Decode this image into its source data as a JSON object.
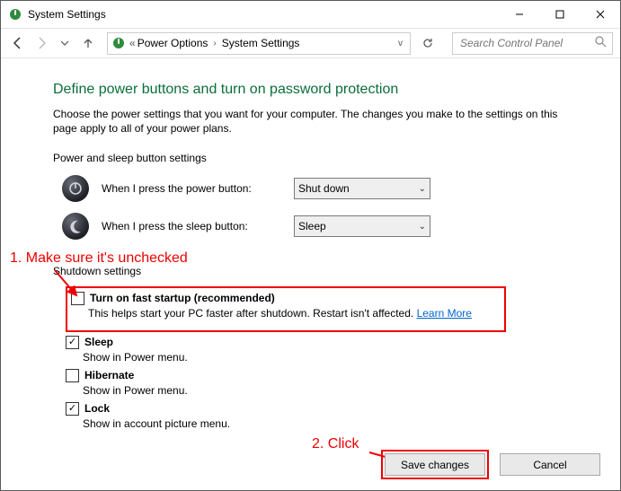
{
  "window": {
    "title": "System Settings"
  },
  "nav": {
    "breadcrumb": {
      "part1": "Power Options",
      "part2": "System Settings"
    },
    "search_placeholder": "Search Control Panel"
  },
  "page": {
    "heading": "Define power buttons and turn on password protection",
    "subhead": "Choose the power settings that you want for your computer. The changes you make to the settings on this page apply to all of your power plans.",
    "section_power_sleep": "Power and sleep button settings",
    "power_button_label": "When I press the power button:",
    "power_button_value": "Shut down",
    "sleep_button_label": "When I press the sleep button:",
    "sleep_button_value": "Sleep",
    "section_shutdown": "Shutdown settings",
    "fast_startup": {
      "label": "Turn on fast startup (recommended)",
      "desc": "This helps start your PC faster after shutdown. Restart isn't affected. ",
      "learn_more": "Learn More"
    },
    "sleep_opt": {
      "label": "Sleep",
      "desc": "Show in Power menu."
    },
    "hibernate_opt": {
      "label": "Hibernate",
      "desc": "Show in Power menu."
    },
    "lock_opt": {
      "label": "Lock",
      "desc": "Show in account picture menu."
    }
  },
  "buttons": {
    "save": "Save changes",
    "cancel": "Cancel"
  },
  "annotations": {
    "a1": "1. Make sure it's unchecked",
    "a2": "2. Click"
  }
}
